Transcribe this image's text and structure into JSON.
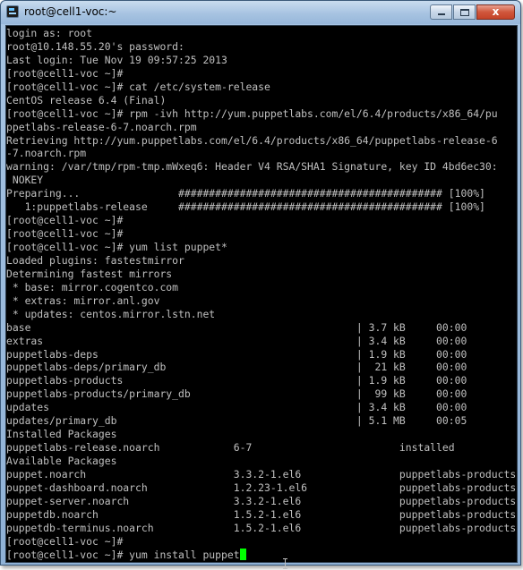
{
  "window": {
    "title": "root@cell1-voc:~",
    "close_glyph": "x",
    "icons": {
      "app": "putty-terminal-icon",
      "minimize": "minimize-icon",
      "maximize": "maximize-icon",
      "close": "close-icon"
    }
  },
  "colors": {
    "terminal_bg": "#000000",
    "terminal_fg": "#c0c0c0",
    "cursor": "#00ff00"
  },
  "terminal": {
    "lines": [
      "login as: root",
      "root@10.148.55.20's password:",
      "Last login: Tue Nov 19 09:57:25 2013",
      "[root@cell1-voc ~]#",
      "[root@cell1-voc ~]# cat /etc/system-release",
      "CentOS release 6.4 (Final)",
      "[root@cell1-voc ~]# rpm -ivh http://yum.puppetlabs.com/el/6.4/products/x86_64/pu",
      "ppetlabs-release-6-7.noarch.rpm",
      "Retrieving http://yum.puppetlabs.com/el/6.4/products/x86_64/puppetlabs-release-6",
      "-7.noarch.rpm",
      "warning: /var/tmp/rpm-tmp.mWxeq6: Header V4 RSA/SHA1 Signature, key ID 4bd6ec30:",
      " NOKEY",
      "Preparing...                ########################################### [100%]",
      "   1:puppetlabs-release     ########################################### [100%]",
      "[root@cell1-voc ~]#",
      "[root@cell1-voc ~]#",
      "[root@cell1-voc ~]# yum list puppet*",
      "Loaded plugins: fastestmirror",
      "Determining fastest mirrors",
      " * base: mirror.cogentco.com",
      " * extras: mirror.anl.gov",
      " * updates: centos.mirror.lstn.net",
      "base                                                     | 3.7 kB     00:00",
      "extras                                                   | 3.4 kB     00:00",
      "puppetlabs-deps                                          | 1.9 kB     00:00",
      "puppetlabs-deps/primary_db                               |  21 kB     00:00",
      "puppetlabs-products                                      | 1.9 kB     00:00",
      "puppetlabs-products/primary_db                           |  99 kB     00:00",
      "updates                                                  | 3.4 kB     00:00",
      "updates/primary_db                                       | 5.1 MB     00:05",
      "Installed Packages",
      "puppetlabs-release.noarch            6-7                        installed",
      "Available Packages",
      "puppet.noarch                        3.3.2-1.el6                puppetlabs-products",
      "puppet-dashboard.noarch              1.2.23-1.el6               puppetlabs-products",
      "puppet-server.noarch                 3.3.2-1.el6                puppetlabs-products",
      "puppetdb.noarch                      1.5.2-1.el6                puppetlabs-products",
      "puppetdb-terminus.noarch             1.5.2-1.el6                puppetlabs-products",
      "[root@cell1-voc ~]#",
      "[root@cell1-voc ~]# yum install puppet"
    ]
  }
}
